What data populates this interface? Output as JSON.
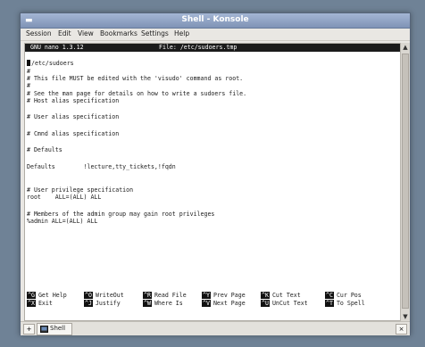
{
  "window": {
    "title": "Shell - Konsole"
  },
  "menubar": [
    "Session",
    "Edit",
    "View",
    "Bookmarks",
    "Settings",
    "Help"
  ],
  "nano": {
    "version": "GNU nano 1.3.12",
    "file": "File: /etc/sudoers.tmp"
  },
  "editor_lines": [
    "/etc/sudoers",
    "#",
    "# This file MUST be edited with the 'visudo' command as root.",
    "#",
    "# See the man page for details on how to write a sudoers file.",
    "# Host alias specification",
    "",
    "# User alias specification",
    "",
    "# Cmnd alias specification",
    "",
    "# Defaults",
    "",
    "Defaults        !lecture,tty_tickets,!fqdn",
    "",
    "# User privilege specification",
    "root    ALL=(ALL) ALL",
    "",
    "# Members of the admin group may gain root privileges",
    "%admin ALL=(ALL) ALL"
  ],
  "shortcuts": [
    {
      "key": "^G",
      "label": "Get Help"
    },
    {
      "key": "^X",
      "label": "Exit"
    },
    {
      "key": "^O",
      "label": "WriteOut"
    },
    {
      "key": "^J",
      "label": "Justify"
    },
    {
      "key": "^R",
      "label": "Read File"
    },
    {
      "key": "^W",
      "label": "Where Is"
    },
    {
      "key": "^Y",
      "label": "Prev Page"
    },
    {
      "key": "^V",
      "label": "Next Page"
    },
    {
      "key": "^K",
      "label": "Cut Text"
    },
    {
      "key": "^U",
      "label": "UnCut Text"
    },
    {
      "key": "^C",
      "label": "Cur Pos"
    },
    {
      "key": "^T",
      "label": "To Spell"
    }
  ],
  "tabs": [
    {
      "label": "Shell"
    }
  ]
}
